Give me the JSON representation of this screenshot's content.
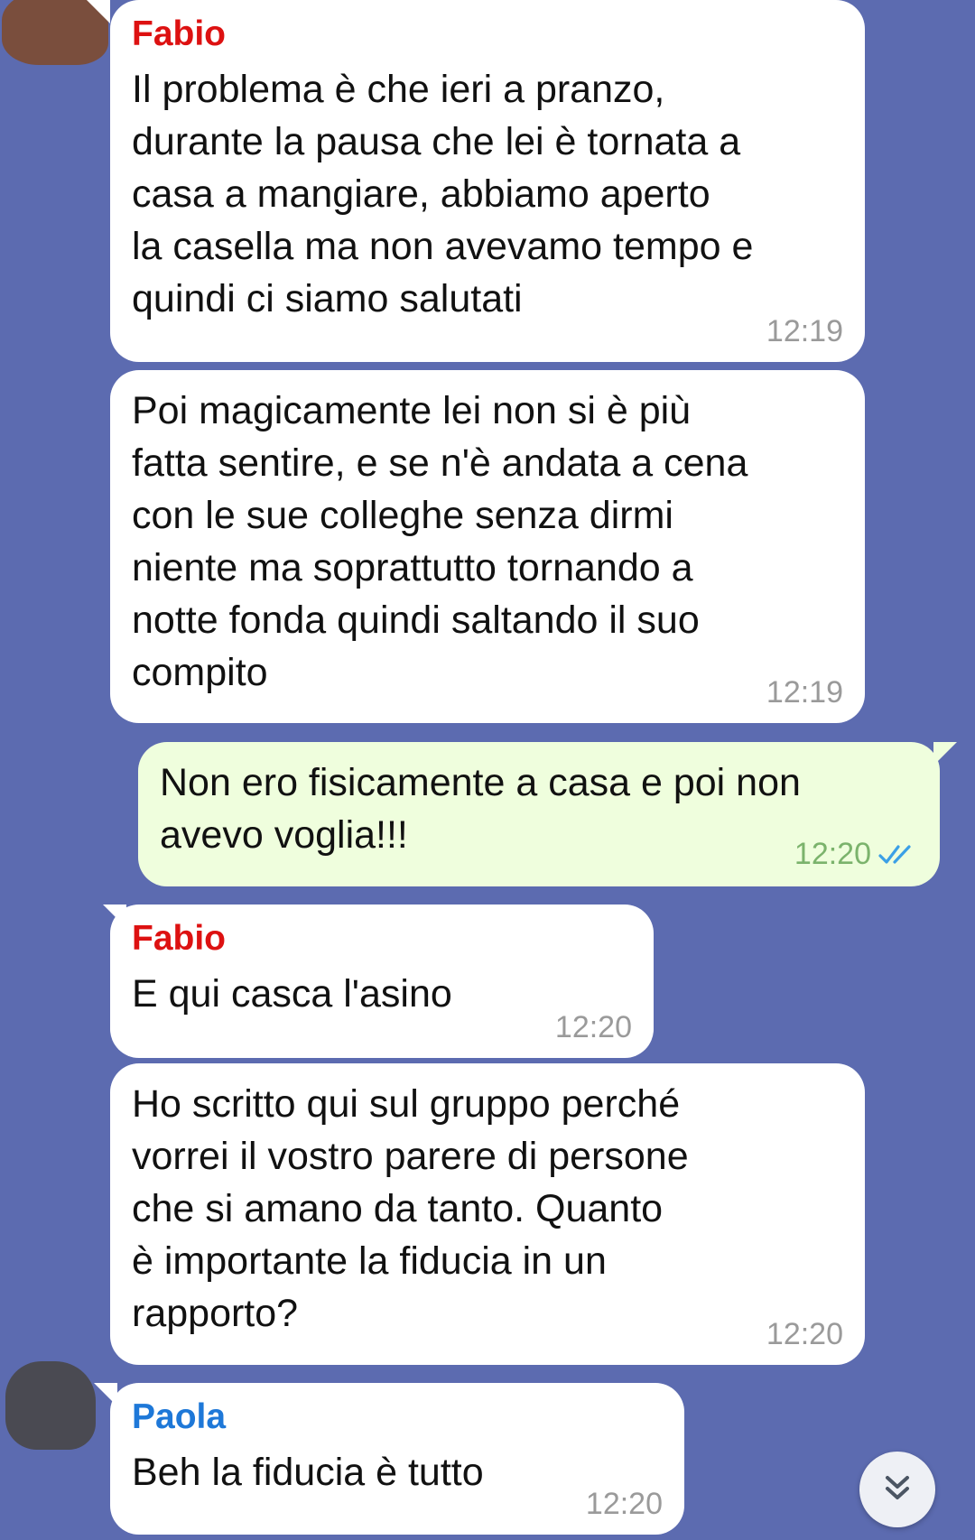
{
  "messages": [
    {
      "sender": "Fabio",
      "sender_color": "#dd1111",
      "text": "Il problema è che ieri a pranzo,\ndurante la pausa che lei è tornata a\ncasa a mangiare, abbiamo aperto\nla casella ma non avevamo tempo e\nquindi ci siamo salutati",
      "time": "12:19"
    },
    {
      "text": "Poi magicamente lei non si è più\nfatta sentire, e se n'è andata a cena\ncon le sue colleghe senza dirmi\nniente ma soprattutto tornando a\nnotte fonda quindi saltando il suo\ncompito",
      "time": "12:19"
    },
    {
      "text": "Non ero fisicamente a casa e poi non\navevo voglia!!!",
      "time": "12:20",
      "status_icon": "double-check-icon",
      "status_color": "#3ba0e6"
    },
    {
      "sender": "Fabio",
      "sender_color": "#dd1111",
      "text": "E qui casca l'asino",
      "time": "12:20"
    },
    {
      "text": "Ho scritto qui sul gruppo perché\nvorrei il vostro parere di persone\nche si amano da tanto. Quanto\nè importante la fiducia in un\nrapporto?",
      "time": "12:20"
    },
    {
      "sender": "Paola",
      "sender_color": "#1e78d8",
      "text": "Beh la fiducia è tutto",
      "time": "12:20"
    }
  ],
  "scroll_button": {
    "icon": "double-chevron-down-icon"
  },
  "colors": {
    "background": "#5c6bb0",
    "incoming_bubble": "#ffffff",
    "outgoing_bubble": "#effedd"
  }
}
